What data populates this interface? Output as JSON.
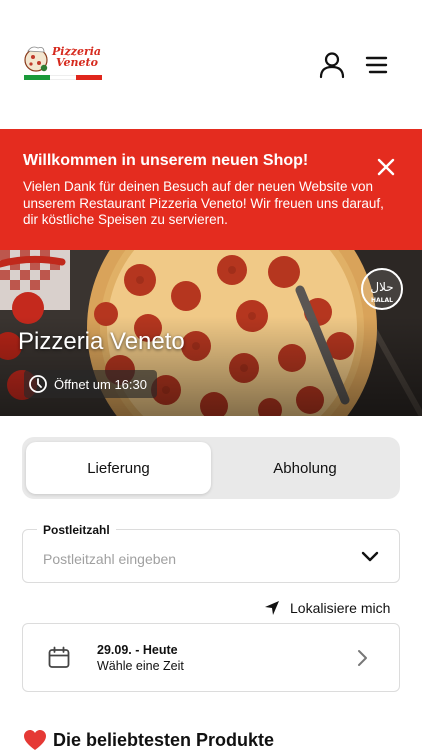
{
  "header": {
    "logo_text_line1": "Pizzeria",
    "logo_text_line2": "Veneto",
    "account_icon": "user-icon",
    "menu_icon": "hamburger-menu-icon",
    "flag_colors": [
      "#1a9a3a",
      "#ffffff",
      "#e0261c"
    ]
  },
  "banner": {
    "title": "Willkommen in unserem neuen Shop!",
    "text": "Vielen Dank für deinen Besuch auf der neuen Website von unserem Restaurant Pizzeria Veneto! Wir freuen uns darauf, dir köstliche Speisen zu servieren.",
    "close_icon": "close-icon",
    "color": "#e42c1f"
  },
  "hero": {
    "restaurant_name": "Pizzeria Veneto",
    "open_status": "Öffnet um 16:30",
    "halal_badge": "HALAL",
    "halal_arabic": "حلال"
  },
  "order_mode": {
    "options": [
      "Lieferung",
      "Abholung"
    ],
    "selected": "Lieferung"
  },
  "postcode": {
    "label": "Postleitzahl",
    "placeholder": "Postleitzahl eingeben",
    "value": ""
  },
  "locate": {
    "label": "Lokalisiere mich"
  },
  "time": {
    "date_label": "29.09. - Heute",
    "hint": "Wähle eine Zeit"
  },
  "popular": {
    "title": "Die beliebtesten Produkte"
  }
}
